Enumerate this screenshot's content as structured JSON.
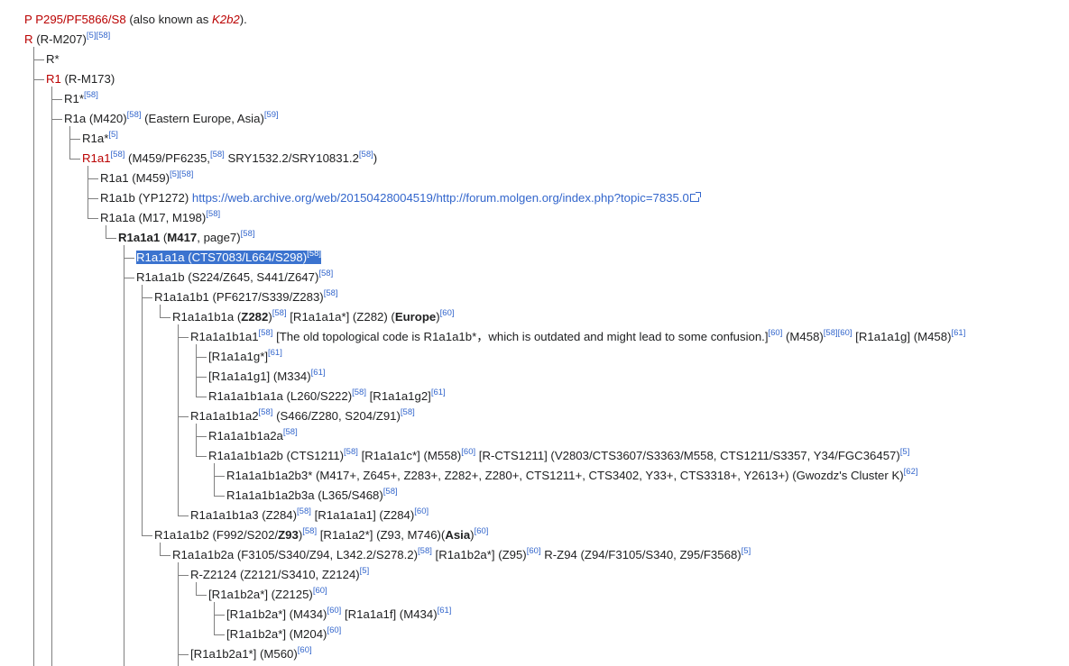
{
  "lines": {
    "p": {
      "link": "P P295/PF5866/S8",
      "text1": " (also known as ",
      "italic": "K2b2",
      "text2": ")."
    },
    "r": {
      "link": "R",
      "text": " (R-M207)",
      "ref1": "[5]",
      "ref2": "[58]"
    },
    "rstar": {
      "text": "R*"
    },
    "r1": {
      "link": "R1",
      "text": " (R-M173)"
    },
    "r1star": {
      "text": "R1*",
      "ref1": "[58]"
    },
    "r1a": {
      "text": "R1a (M420)",
      "ref1": "[58]",
      "text2": " (Eastern Europe, Asia)",
      "ref2": "[59]"
    },
    "r1astar": {
      "text": "R1a*",
      "ref1": "[5]"
    },
    "r1a1": {
      "link": "R1a1",
      "ref1": "[58]",
      "text": " (M459/PF6235,",
      "ref2": "[58]",
      "text2": " SRY1532.2/SRY10831.2",
      "ref3": "[58]",
      "text3": ")"
    },
    "r1a1_m459": {
      "text": "R1a1 (M459)",
      "ref1": "[5]",
      "ref2": "[58]"
    },
    "r1a1b": {
      "text": "R1a1b (YP1272) ",
      "url": "https://web.archive.org/web/20150428004519/http://forum.molgen.org/index.php?topic=7835.0"
    },
    "r1a1a": {
      "text": "R1a1a (M17, M198)",
      "ref1": "[58]"
    },
    "r1a1a1": {
      "bold1": "R1a1a1",
      "text1": " (",
      "bold2": "M417",
      "text2": ", page7)",
      "ref1": "[58]"
    },
    "r1a1a1a": {
      "text": "R1a1a1a (CTS7083/L664/S298)",
      "ref1": "[58]"
    },
    "r1a1a1b": {
      "text": "R1a1a1b (S224/Z645, S441/Z647)",
      "ref1": "[58]"
    },
    "r1a1a1b1": {
      "text": "R1a1a1b1 (PF6217/S339/Z283)",
      "ref1": "[58]"
    },
    "r1a1a1b1a": {
      "text1": "R1a1a1b1a (",
      "bold1": "Z282",
      "text2": ")",
      "ref1": "[58]",
      "text3": " [R1a1a1a*] (Z282) (",
      "bold2": "Europe",
      "text4": ")",
      "ref2": "[60]"
    },
    "r1a1a1b1a1": {
      "text1": "R1a1a1b1a1",
      "ref1": "[58]",
      "text2": " [The old topological code is R1a1a1b*，which is outdated and might lead to some confusion.]",
      "ref2": "[60]",
      "text3": " (M458)",
      "ref3": "[58]",
      "ref4": "[60]",
      "text4": " [R1a1a1g] (M458)",
      "ref5": "[61]"
    },
    "g_star": {
      "text": "[R1a1a1g*]",
      "ref1": "[61]"
    },
    "g1": {
      "text": "[R1a1a1g1] (M334)",
      "ref1": "[61]"
    },
    "b1a1a": {
      "text": "R1a1a1b1a1a (L260/S222)",
      "ref1": "[58]",
      "text2": " [R1a1a1g2]",
      "ref2": "[61]"
    },
    "b1a2": {
      "text": "R1a1a1b1a2",
      "ref1": "[58]",
      "text2": " (S466/Z280, S204/Z91)",
      "ref2": "[58]"
    },
    "b1a2a": {
      "text": "R1a1a1b1a2a",
      "ref1": "[58]"
    },
    "b1a2b": {
      "text": "R1a1a1b1a2b (CTS1211)",
      "ref1": "[58]",
      "text2": " [R1a1a1c*] (M558)",
      "ref2": "[60]",
      "text3": " [R-CTS1211] (V2803/CTS3607/S3363/M558, CTS1211/S3357, Y34/FGC36457)",
      "ref3": "[5]"
    },
    "b1a2b3star": {
      "text": "R1a1a1b1a2b3* (M417+, Z645+, Z283+, Z282+, Z280+, CTS1211+, CTS3402, Y33+, CTS3318+, Y2613+) (Gwozdz's Cluster K)",
      "ref1": "[62]"
    },
    "b1a2b3a": {
      "text": "R1a1a1b1a2b3a (L365/S468)",
      "ref1": "[58]"
    },
    "b1a3": {
      "text": "R1a1a1b1a3 (Z284)",
      "ref1": "[58]",
      "text2": " [R1a1a1a1] (Z284)",
      "ref2": "[60]"
    },
    "b2": {
      "text1": "R1a1a1b2 (F992/S202/",
      "bold1": "Z93",
      "text2": ")",
      "ref1": "[58]",
      "text3": " [R1a1a2*] (Z93, M746)(",
      "bold2": "Asia",
      "text4": ")",
      "ref2": "[60]"
    },
    "b2a": {
      "text": "R1a1a1b2a (F3105/S340/Z94, L342.2/S278.2)",
      "ref1": "[58]",
      "text2": " [R1a1b2a*] (Z95)",
      "ref2": "[60]",
      "text3": " R-Z94 (Z94/F3105/S340, Z95/F3568)",
      "ref3": "[5]"
    },
    "rz2124": {
      "text": "R-Z2124 (Z2121/S3410, Z2124)",
      "ref1": "[5]"
    },
    "z2125": {
      "text": "[R1a1b2a*] (Z2125)",
      "ref1": "[60]"
    },
    "m434": {
      "text": "[R1a1b2a*] (M434)",
      "ref1": "[60]",
      "text2": " [R1a1a1f] (M434)",
      "ref2": "[61]"
    },
    "m204": {
      "text": "[R1a1b2a*] (M204)",
      "ref1": "[60]"
    },
    "m560": {
      "text": "[R1a1b2a1*] (M560)",
      "ref1": "[60]"
    }
  },
  "icons": {
    "external_link": "external-link-icon"
  },
  "colors": {
    "link_red": "#ba0000",
    "ref_blue": "#3366cc",
    "selection": "#3b73cf",
    "tree_line": "#808080"
  }
}
